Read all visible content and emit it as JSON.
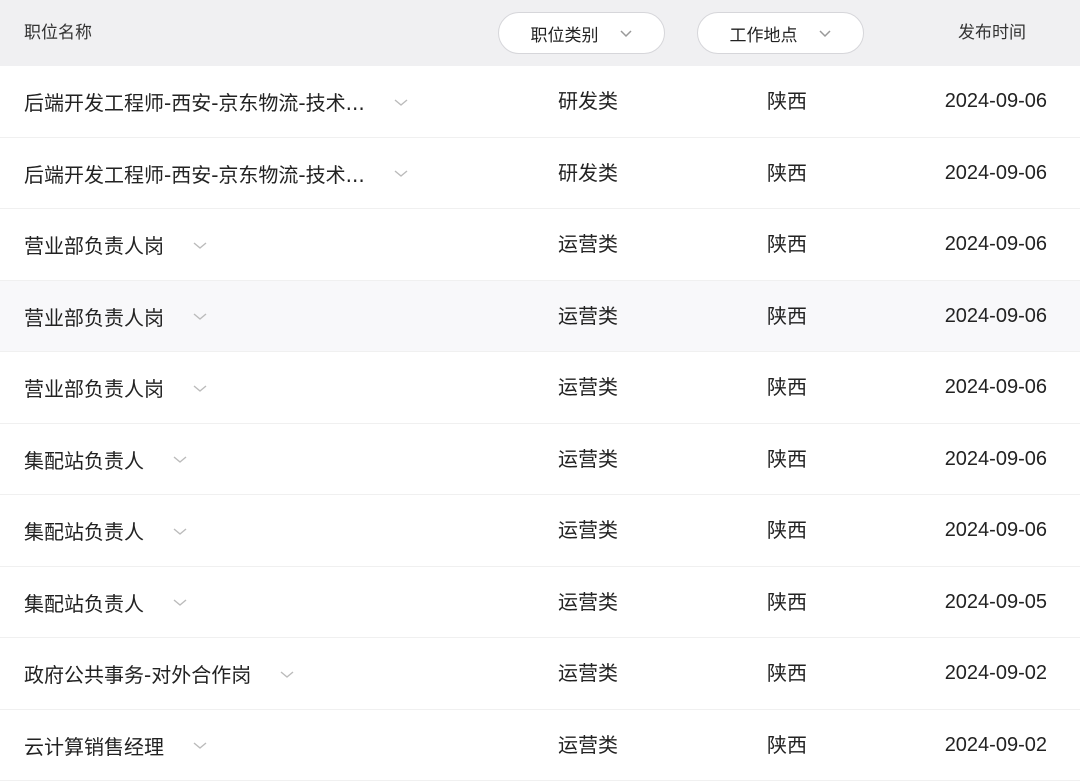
{
  "header": {
    "title_label": "职位名称",
    "category_filter_label": "职位类别",
    "location_filter_label": "工作地点",
    "date_label": "发布时间"
  },
  "rows": [
    {
      "title": "后端开发工程师-西安-京东物流-技术...",
      "category": "研发类",
      "location": "陕西",
      "date": "2024-09-06"
    },
    {
      "title": "后端开发工程师-西安-京东物流-技术...",
      "category": "研发类",
      "location": "陕西",
      "date": "2024-09-06"
    },
    {
      "title": "营业部负责人岗",
      "category": "运营类",
      "location": "陕西",
      "date": "2024-09-06"
    },
    {
      "title": "营业部负责人岗",
      "category": "运营类",
      "location": "陕西",
      "date": "2024-09-06"
    },
    {
      "title": "营业部负责人岗",
      "category": "运营类",
      "location": "陕西",
      "date": "2024-09-06"
    },
    {
      "title": "集配站负责人",
      "category": "运营类",
      "location": "陕西",
      "date": "2024-09-06"
    },
    {
      "title": "集配站负责人",
      "category": "运营类",
      "location": "陕西",
      "date": "2024-09-06"
    },
    {
      "title": "集配站负责人",
      "category": "运营类",
      "location": "陕西",
      "date": "2024-09-05"
    },
    {
      "title": "政府公共事务-对外合作岗",
      "category": "运营类",
      "location": "陕西",
      "date": "2024-09-02"
    },
    {
      "title": "云计算销售经理",
      "category": "运营类",
      "location": "陕西",
      "date": "2024-09-02"
    }
  ],
  "highlighted_row_index": 3,
  "icons": {
    "filter": "chevron-down-icon",
    "row_expand": "chevron-down-icon"
  },
  "colors": {
    "header_bg": "#f0f0f2",
    "row_highlight_bg": "#f8f8fa",
    "text": "#222222",
    "chevron": "#bbbbbb"
  }
}
